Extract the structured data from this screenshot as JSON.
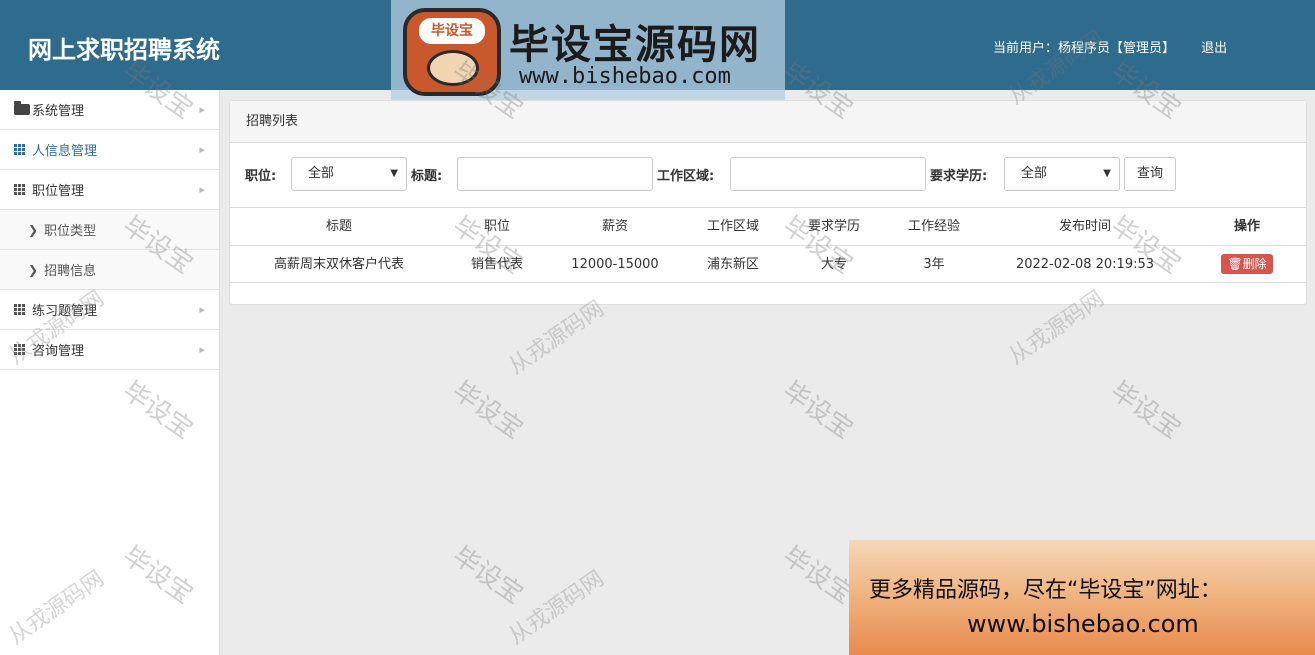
{
  "app": {
    "title": "网上求职招聘系统"
  },
  "header": {
    "current_user": "当前用户：杨程序员【管理员】",
    "logout": "退出"
  },
  "logo": {
    "badge": "毕设宝",
    "name": "毕设宝源码网",
    "url": "www.bishebao.com"
  },
  "sidebar": {
    "items": [
      {
        "label": "系统管理",
        "icon": "folder-open-icon"
      },
      {
        "label": "人信息管理",
        "icon": "grid-icon"
      },
      {
        "label": "职位管理",
        "icon": "grid-icon"
      },
      {
        "label": "职位类型",
        "icon": "chevron-right-icon"
      },
      {
        "label": "招聘信息",
        "icon": "chevron-right-icon"
      },
      {
        "label": "练习题管理",
        "icon": "grid-icon"
      },
      {
        "label": "咨询管理",
        "icon": "grid-icon"
      }
    ]
  },
  "panel": {
    "title": "招聘列表"
  },
  "filter": {
    "position_label": "职位:",
    "position_value": "全部",
    "title_label": "标题:",
    "title_value": "",
    "area_label": "工作区域:",
    "area_value": "",
    "edu_label": "要求学历:",
    "edu_value": "全部",
    "search_button": "查询"
  },
  "table": {
    "headers": [
      "标题",
      "职位",
      "薪资",
      "工作区域",
      "要求学历",
      "工作经验",
      "发布时间",
      "操作"
    ],
    "rows": [
      {
        "title": "高薪周末双休客户代表",
        "position": "销售代表",
        "salary": "12000-15000",
        "area": "浦东新区",
        "education": "大专",
        "experience": "3年",
        "published": "2022-02-08 20:19:53",
        "action": "删除"
      }
    ]
  },
  "watermarks": {
    "a": "毕设宝",
    "b": "从戎源码网"
  },
  "ad": {
    "line1": "更多精品源码，尽在“毕设宝”网址：",
    "line2": "www.bishebao.com"
  },
  "colors": {
    "topbar": "#2f6b8c",
    "active_nav": "#2b6ea5",
    "danger": "#d9534f"
  }
}
